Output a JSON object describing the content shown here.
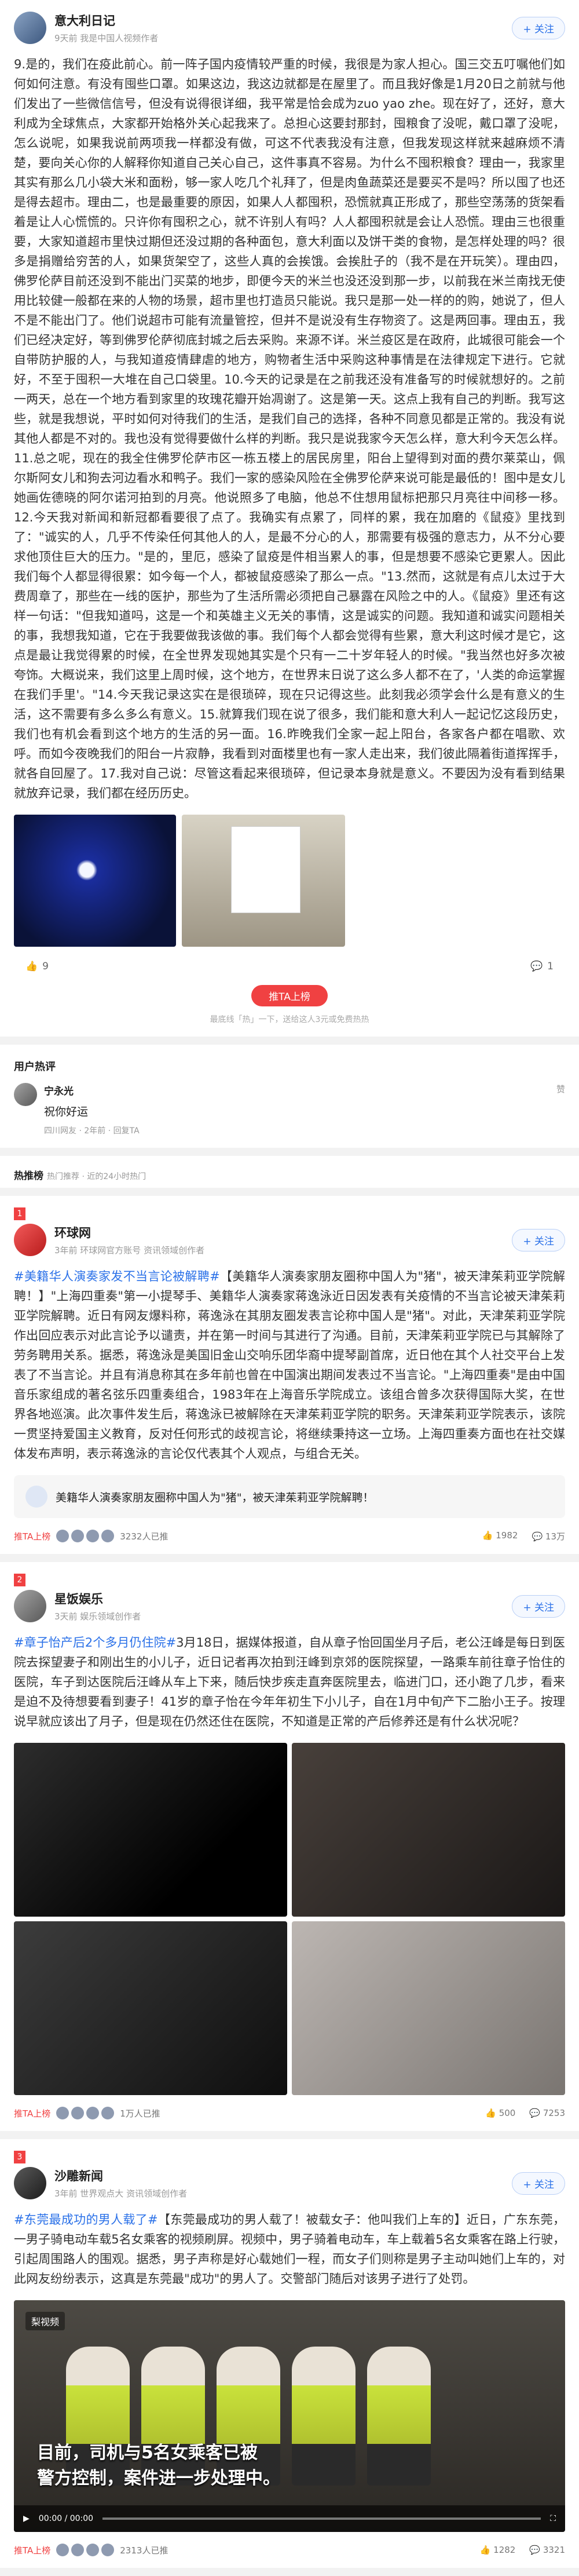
{
  "post1": {
    "username": "意大利日记",
    "meta": "9天前 我是中国人视频作者",
    "follow": "+ 关注",
    "text": "9.是的，我们在疫此前心。前一阵子国内疫情较严重的时候，我很是为家人担心。国三交五叮嘱他们如何如何注意。有没有囤些口罩。如果这边，我这边就都是在屋里了。而且我好像是1月20日之前就与他们发出了一些微信信号，但没有说得很详细，我平常是恰会成为zuo yao zhe。现在好了，还好，意大利成为全球焦点，大家都开始格外关心起我来了。总担心这要封那封，囤粮食了没呢，戴口罩了没呢，怎么说呢，如果我说前两项我一样都没有做，可这不代表我没有注意，但我发现这样就来越麻烦不清楚，要向关心你的人解释你知道自己关心自己，这件事真不容易。为什么不囤积粮食？理由一，我家里其实有那么几小袋大米和面粉，够一家人吃几个礼拜了，但是肉鱼蔬菜还是要买不是吗？所以囤了也还是得去超市。理由二，也是最重要的原因，如果人人都囤积，恐慌就真正形成了，那些空荡荡的货架看着是让人心慌慌的。只许你有囤积之心，就不许别人有吗？人人都囤积就是会让人恐慌。理由三也很重要，大家知道超市里快过期但还没过期的各种面包，意大利面以及饼干类的食物，是怎样处理的吗？很多是捐赠给穷苦的人，如果货架空了，这些人真的会挨饿。会挨肚子的（我不是在开玩笑）。理由四，佛罗伦萨目前还没到不能出门买菜的地步，即便今天的米兰也没还没到那一步，以前我在米兰南找无使用比较健一般都在来的人物的场景，超市里也打造员只能说。我只是那一处一样的的购，她说了，但人不是不能出门了。他们说超市可能有流量管控，但并不是说没有生存物资了。这是两回事。理由五，我们已经决定好，等到佛罗伦萨彻底封城之后去采购。来源不详。米兰疫区是在政府，此城很可能会一个自带防护服的人，与我知道疫情肆虐的地方，购物者生活中采购这种事情是在法律规定下进行。它就好，不至于囤积一大堆在自己口袋里。10.今天的记录是在之前我还没有准备写的时候就想好的。之前一两天，总在一个地方看到家里的玫瑰花瓣开始凋谢了。这是第一天。这点上我有自己的判断。我写这些，就是我想说，平时如何对待我们的生活，是我们自己的选择，各种不同意见都是正常的。我没有说其他人都是不对的。我也没有觉得要做什么样的判断。我只是说我家今天怎么样，意大利今天怎么样。11.总之呢，现在的我全住佛罗伦萨市区一栋五楼上的居民房里，阳台上望得到对面的费尔莱菜山，佩尔斯阿女儿和狗去河边看水和鸭子。我们一家的感染风险在全佛罗伦萨来说可能是最低的！图中是女儿她画佐德晓的阿尔诺河拍到的月亮。他说照多了电脑，他总不住想用鼠标把那只月亮往中间移一移。12.今天我对新闻和新冠都看要很了点了。我确实有点累了，同样的累，我在加磨的《鼠疫》里找到了：\"诚实的人，几乎不传染任何其他人的人，是最不分心的人，那需要有极强的意志力，从不分心要求他顶住巨大的压力。\"是的，里厄，感染了鼠疫是件相当累人的事，但是想要不感染它更累人。因此我们每个人都显得很累：如今每一个人，都被鼠疫感染了那么一点。\"13.然而，这就是有点儿太过于大费周章了，那些在一线的医护，那些为了生活所需必须把自己暴露在风险之中的人。《鼠疫》里还有这样一句话：\"但我知道吗，这是一个和英雄主义无关的事情，这是诚实的问题。我知道和诚实问题相关的事，我想我知道，它在于我要做我该做的事。我们每个人都会觉得有些累，意大利这时候才是它，这点是最让我觉得累的时候，在全世界发现她其实是个只有一二十岁年轻人的时候。\"我当然也好多次被夸饰。大概说来，我们这里上周时候，这个地方，在世界末日说了这么多人都不在了，'人类的命运掌握在我们手里'。\"14.今天我记录这实在是很琐碎，现在只记得这些。此刻我必须学会什么是有意义的生活，这不需要有多么多么有意义。15.就算我们现在说了很多，我们能和意大利人一起记忆这段历史，我们也有机会看到这个地方的生活的另一面。16.昨晚我们全家一起上阳台，各家各户都在唱歌、欢呼。而如今夜晚我们的阳台一片寂静，我看到对面楼里也有一家人走出来，我们彼此隔着街道挥挥手，就各自回屋了。17.我对自己说：尽管这看起来很琐碎，但记录本身就是意义。不要因为没有看到结果就放弃记录，我们都在经历历史。",
    "like_count": "9",
    "comment_count": "1",
    "hot_button": "推TA上榜",
    "hot_note": "最底线「热」一下，送给这人3元或免费热热"
  },
  "comments": {
    "title": "用户热评",
    "items": [
      {
        "name": "宁永光",
        "text": "祝你好运",
        "meta": "四川网友 · 2年前 · 回复TA",
        "like": "赞"
      }
    ]
  },
  "hotlist": {
    "label": "热推榜",
    "sublabel": "热门推荐 · 近的24小时热门",
    "items": [
      {
        "rank": "1",
        "username": "环球网",
        "meta": "3年前 环球网官方账号 资讯领域创作者",
        "follow": "+ 关注",
        "hashtag": "#美籍华人演奏家发不当言论被解聘#",
        "text": "【美籍华人演奏家朋友圈称中国人为\"猪\"，被天津茱莉亚学院解聘！】\"上海四重奏\"第一小提琴手、美籍华人演奏家蒋逸泳近日因发表有关疫情的不当言论被天津茱莉亚学院解聘。近日有网友爆料称，蒋逸泳在其朋友圈发表言论称中国人是\"猪\"。对此，天津茱莉亚学院作出回应表示对此言论予以谴责，并在第一时间与其进行了沟通。目前，天津茱莉亚学院已与其解除了劳务聘用关系。据悉，蒋逸泳是美国旧金山交响乐团华裔中提琴副首席，近日他在其个人社交平台上发表了不当言论。并且有消息称其在多年前也曾在中国演出期间发表过不当言论。\"上海四重奏\"是由中国音乐家组成的著名弦乐四重奏组合，1983年在上海音乐学院成立。该组合曾多次获得国际大奖，在世界各地巡演。此次事件发生后，蒋逸泳已被解除在天津茱莉亚学院的职务。天津茱莉亚学院表示，该院一贯坚持爱国主义教育，反对任何形式的歧视言论，将继续秉持这一立场。上海四重奏方面也在社交媒体发布声明，表示蒋逸泳的言论仅代表其个人观点，与组合无关。",
        "quote": "美籍华人演奏家朋友圈称中国人为\"猪\"，被天津茱莉亚学院解聘！",
        "hot_button": "推TA上榜",
        "count_text": "3232人已推",
        "like_count": "1982",
        "comment_count": "13万"
      },
      {
        "rank": "2",
        "username": "星饭娱乐",
        "meta": "3天前 娱乐领域创作者",
        "follow": "+ 关注",
        "hashtag": "#章子怡产后2个多月仍住院#",
        "text": "3月18日，据媒体报道，自从章子怡回国坐月子后，老公汪峰是每日到医院去探望妻子和刚出生的小儿子，近日记者再次拍到汪峰到京郊的医院探望，一路乘车前往章子怡住的医院，车子到达医院后汪峰从车上下来，随后快步疾走直奔医院里去，临进门口，还小跑了几步，看来是迫不及待想要看到妻子！41岁的章子怡在今年年初生下小儿子，自在1月中旬产下二胎小王子。按理说早就应该出了月子，但是现在仍然还住在医院，不知道是正常的产后修养还是有什么状况呢？",
        "hot_button": "推TA上榜",
        "count_text": "1万人已推",
        "like_count": "500",
        "comment_count": "7253"
      },
      {
        "rank": "3",
        "username": "沙雕新闻",
        "meta": "3年前 世界观点大 资讯领域创作者",
        "follow": "+ 关注",
        "hashtag": "#东莞最成功的男人载了#",
        "text": "【东莞最成功的男人载了！被载女子：他叫我们上车的】近日，广东东莞，一男子骑电动车载5名女乘客的视频刷屏。视频中，男子骑着电动车，车上载着5名女乘客在路上行驶，引起周围路人的围观。据悉，男子声称是好心载她们一程，而女子们则称是男子主动叫她们上车的，对此网友纷纷表示，这真是东莞最\"成功\"的男人了。交警部门随后对该男子进行了处罚。",
        "video_tag": "梨视频",
        "video_caption": "目前，司机与5名女乘客已被\n警方控制，案件进一步处理中。",
        "video_time": "00:00 / 00:00",
        "hot_button": "推TA上榜",
        "count_text": "2313人已推",
        "like_count": "1282",
        "comment_count": "3321"
      }
    ]
  }
}
